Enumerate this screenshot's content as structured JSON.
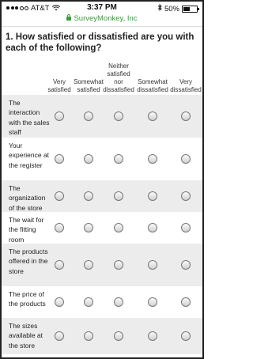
{
  "status_bar": {
    "carrier": "AT&T",
    "time": "3:37 PM",
    "battery": "50%"
  },
  "browser": {
    "url": "SurveyMonkey, Inc"
  },
  "question": {
    "title": "1. How satisfied or dissatisfied are you with each of the following?"
  },
  "columns": [
    {
      "label": "Very satisfied"
    },
    {
      "label": "Somewhat satisfied"
    },
    {
      "label": "Neither satisfied nor dissatisfied"
    },
    {
      "label": "Somewhat dissatisfied"
    },
    {
      "label": "Very dissatisfied"
    }
  ],
  "rows": [
    {
      "label": "The interaction with the sales staff",
      "shaded": true
    },
    {
      "label": "Your experience at the register",
      "shaded": false
    },
    {
      "label": "The organization of the store",
      "shaded": true
    },
    {
      "label": "The wait for the fitting room",
      "shaded": false
    },
    {
      "label": "The products offered in the store",
      "shaded": true
    },
    {
      "label": "The price of the products",
      "shaded": false
    },
    {
      "label": "The sizes available at the store",
      "shaded": true
    }
  ],
  "icons": {
    "signal": "signal-dots-icon",
    "wifi": "wifi-icon",
    "bluetooth": "bluetooth-icon",
    "battery": "battery-icon",
    "lock": "lock-icon",
    "radio": "radio-button-icon"
  },
  "colors": {
    "secure_url": "#3d9a3d",
    "row_shade": "#ececec"
  }
}
